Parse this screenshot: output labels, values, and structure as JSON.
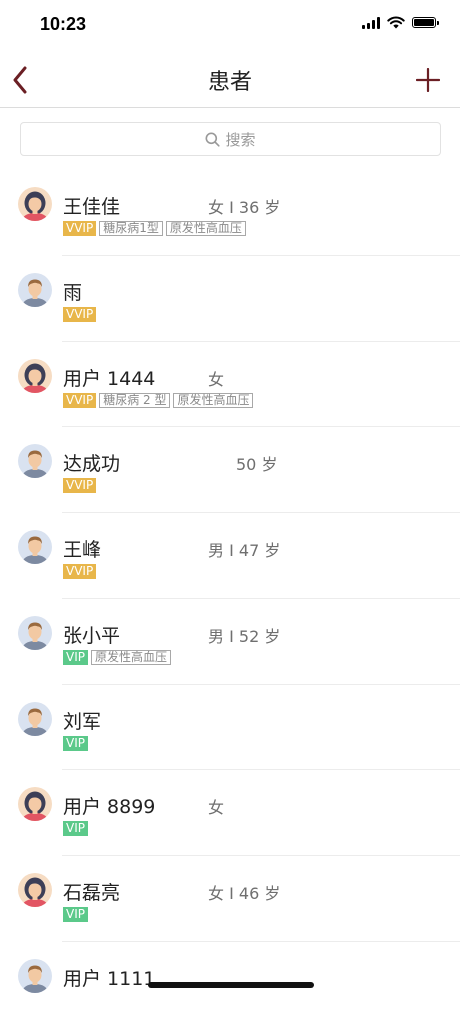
{
  "status_bar": {
    "time": "10:23"
  },
  "nav": {
    "title": "患者"
  },
  "search": {
    "placeholder": "搜索"
  },
  "colors": {
    "vvip": "#e8b64a",
    "vip": "#5bc98a",
    "back_arrow": "#6b1f24"
  },
  "patients": [
    {
      "name": "王佳佳",
      "info": "女 I 36 岁",
      "avatar": "female",
      "tags": [
        {
          "type": "vvip",
          "label": "VVIP"
        },
        {
          "type": "disease",
          "label": "糖尿病1型"
        },
        {
          "type": "disease",
          "label": "原发性高血压"
        }
      ]
    },
    {
      "name": "雨",
      "info": "",
      "avatar": "male",
      "tags": [
        {
          "type": "vvip",
          "label": "VVIP"
        }
      ]
    },
    {
      "name": "用户 1444",
      "info": "女",
      "avatar": "female",
      "tags": [
        {
          "type": "vvip",
          "label": "VVIP"
        },
        {
          "type": "disease",
          "label": "糖尿病 2 型"
        },
        {
          "type": "disease",
          "label": "原发性高血压"
        }
      ]
    },
    {
      "name": "达成功",
      "info": "50 岁",
      "avatar": "male",
      "tags": [
        {
          "type": "vvip",
          "label": "VVIP"
        }
      ]
    },
    {
      "name": "王峰",
      "info": "男 I 47 岁",
      "avatar": "male",
      "tags": [
        {
          "type": "vvip",
          "label": "VVIP"
        }
      ]
    },
    {
      "name": "张小平",
      "info": "男 I 52 岁",
      "avatar": "male",
      "tags": [
        {
          "type": "vip",
          "label": "VIP"
        },
        {
          "type": "disease",
          "label": "原发性高血压"
        }
      ]
    },
    {
      "name": "刘军",
      "info": "",
      "avatar": "male",
      "tags": [
        {
          "type": "vip",
          "label": "VIP"
        }
      ]
    },
    {
      "name": "用户 8899",
      "info": "女",
      "avatar": "female",
      "tags": [
        {
          "type": "vip",
          "label": "VIP"
        }
      ]
    },
    {
      "name": "石磊亮",
      "info": "女 I 46 岁",
      "avatar": "female",
      "tags": [
        {
          "type": "vip",
          "label": "VIP"
        }
      ]
    },
    {
      "name": "用户 1111",
      "info": "",
      "avatar": "male",
      "tags": []
    }
  ]
}
